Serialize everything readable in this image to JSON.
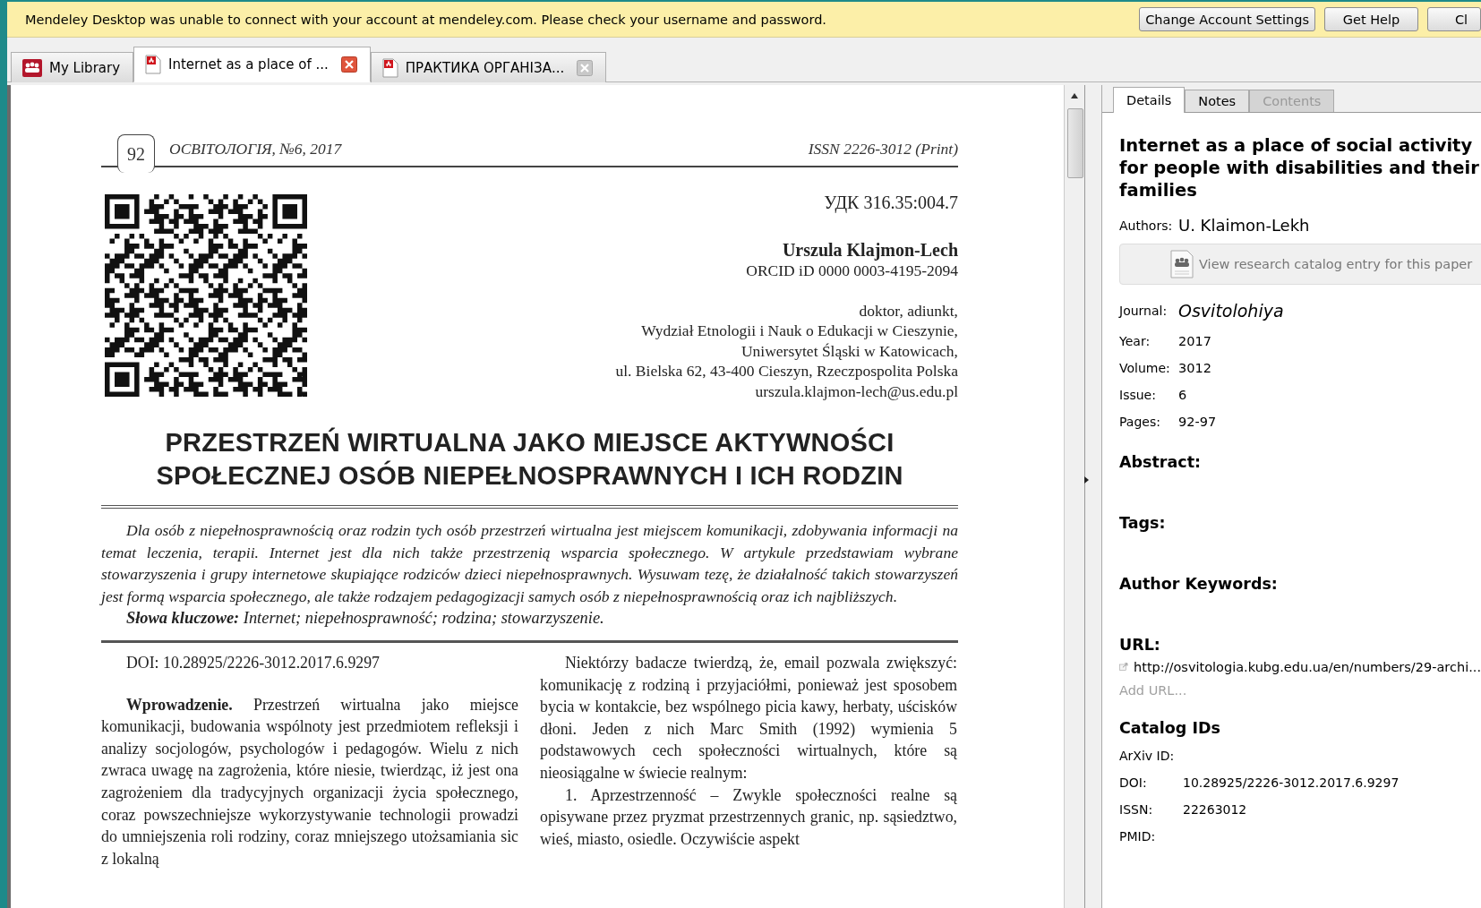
{
  "notice": {
    "message": "Mendeley Desktop was unable to connect with your account at mendeley.com. Please check your username and password.",
    "buttons": [
      "Change Account Settings",
      "Get Help",
      "Cl"
    ]
  },
  "doc_tabs": [
    {
      "label": "My Library",
      "kind": "library",
      "selected": false
    },
    {
      "label": "Internet as a place of ...",
      "kind": "pdf",
      "selected": true
    },
    {
      "label": "ПРАКТИКА ОРГАНІЗА...",
      "kind": "pdf",
      "selected": false
    }
  ],
  "pdf_page": {
    "page_number": "92",
    "journal": "ОСВІТОЛОГІЯ, №6, 2017",
    "issn": "ISSN 2226-3012 (Print)",
    "udk": "УДК 316.35:004.7",
    "author": "Urszula Klajmon-Lech",
    "orcid": "ORCID iD 0000 0003-4195-2094",
    "affiliation": [
      "doktor, adiunkt,",
      "Wydział Etnologii i Nauk o Edukacji w Cieszynie,",
      "Uniwersytet Śląski w Katowicach,",
      "ul. Bielska 62, 43-400 Cieszyn, Rzeczpospolita Polska",
      "urszula.klajmon-lech@us.edu.pl"
    ],
    "title": [
      "PRZESTRZEŃ WIRTUALNA JAKO MIEJSCE AKTYWNOŚCI",
      "SPOŁECZNEJ OSÓB NIEPEŁNOSPRAWNYCH I ICH RODZIN"
    ],
    "abstract": "Dla osób z niepełnosprawnością oraz rodzin tych osób przestrzeń wirtualna jest miejscem komunikacji, zdobywania informacji na temat leczenia, terapii. Internet jest dla nich także przestrzenią wsparcia społecznego. W artykule przedstawiam wybrane stowarzyszenia i grupy internetowe skupiające rodziców dzieci niepełnosprawnych. Wysuwam tezę, że działalność takich stowarzyszeń jest formą wsparcia społecznego, ale także rodzajem pedagogizacji samych osób z niepełnosprawnością oraz ich najbliższych.",
    "keywords": "**Słowa kluczowe:** Internet; niepełnosprawność; rodzina; stowarzyszenie.",
    "left_column": [
      "DOI: 10.28925/2226-3012.2017.6.9297",
      "**Wprowadzenie.** Przestrzeń wirtualna jako miejsce komunikacji, budowania wspólnoty jest przedmiotem refleksji i analizy socjologów, psychologów i pedagogów. Wielu z nich zwraca uwagę na zagrożenia, które niesie, twierdząc, iż jest ona zagrożeniem dla tradycyjnych organizacji życia społecznego, coraz powszechniejsze wykorzystywanie technologii prowadzi do umniejszenia roli rodziny, coraz mniejszego utożsamiania sic z lokalną"
    ],
    "right_column": [
      "Niektórzy badacze twierdzą, że, email pozwala zwiększyć: komunikację z rodziną i przyjaciółmi, ponieważ jest sposobem bycia w kontakcie, bez wspólnego picia kawy, herbaty, uścisków dłoni. Jeden z nich Marc Smith (1992) wymienia 5 podstawowych cech społeczności wirtualnych, które są nieosiągalne w świecie realnym:",
      "1.    Aprzestrzenność – Zwykle społeczności realne są opisywane przez pryzmat przestrzennych granic, np. sąsiedztwo, wieś, miasto, osiedle. Oczywiście aspekt"
    ]
  },
  "panel_tabs": [
    {
      "label": "Details",
      "selected": true,
      "disabled": false
    },
    {
      "label": "Notes",
      "selected": false,
      "disabled": false
    },
    {
      "label": "Contents",
      "selected": false,
      "disabled": true
    }
  ],
  "details": {
    "title": "Internet as a place of social activity for people with disabilities and their families",
    "authors_label": "Authors:",
    "authors": "U. Klaimon-Lekh",
    "catalog_button": "View research catalog entry for this paper",
    "fields": [
      {
        "label": "Journal:",
        "value": "Osvitolohiya",
        "kind": "journal"
      },
      {
        "label": "Year:",
        "value": "2017",
        "kind": "plain"
      },
      {
        "label": "Volume:",
        "value": "3012",
        "kind": "plain"
      },
      {
        "label": "Issue:",
        "value": "6",
        "kind": "plain"
      },
      {
        "label": "Pages:",
        "value": "92-97",
        "kind": "plain"
      }
    ],
    "sections": [
      "Abstract:",
      "Tags:",
      "Author Keywords:"
    ],
    "url_heading": "URL:",
    "url": "http://osvitologia.kubg.edu.ua/en/numbers/29-archi...",
    "add_url": "Add URL...",
    "catalog_heading": "Catalog IDs",
    "catalog_ids": [
      {
        "label": "ArXiv ID:"
      },
      {
        "label": "DOI:",
        "value": "10.28925/2226-3012.2017.6.9297"
      },
      {
        "label": "ISSN:",
        "value": "22263012"
      },
      {
        "label": "PMID:"
      }
    ]
  }
}
